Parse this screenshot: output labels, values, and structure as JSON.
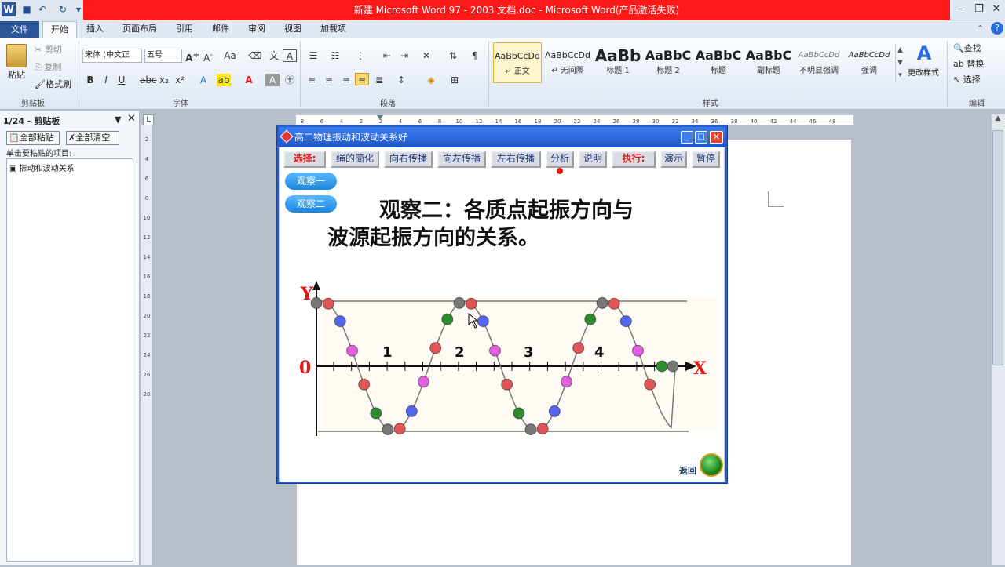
{
  "window": {
    "title": "新建 Microsoft Word 97 - 2003 文档.doc - Microsoft Word(产品激活失败)"
  },
  "tabs": [
    "文件",
    "开始",
    "插入",
    "页面布局",
    "引用",
    "邮件",
    "审阅",
    "视图",
    "加载项"
  ],
  "clipboard": {
    "paste": "粘贴",
    "cut": "剪切",
    "copy": "复制",
    "format_painter": "格式刷",
    "label": "剪贴板"
  },
  "font": {
    "name": "宋体 (中文正",
    "size": "五号",
    "label": "字体"
  },
  "paragraph": {
    "label": "段落"
  },
  "styles": {
    "label": "样式",
    "items": [
      {
        "preview": "AaBbCcDd",
        "name": "↵ 正文"
      },
      {
        "preview": "AaBbCcDd",
        "name": "↵ 无间隔"
      },
      {
        "preview": "AaBb",
        "name": "标题 1"
      },
      {
        "preview": "AaBbC",
        "name": "标题 2"
      },
      {
        "preview": "AaBbC",
        "name": "标题"
      },
      {
        "preview": "AaBbC",
        "name": "副标题"
      },
      {
        "preview": "AaBbCcDd",
        "name": "不明显强调"
      },
      {
        "preview": "AaBbCcDd",
        "name": "强调"
      }
    ],
    "change_styles": "更改样式"
  },
  "editing": {
    "find": "查找",
    "replace": "替换",
    "select": "选择",
    "label": "编辑"
  },
  "clip_pane": {
    "title": "1/24 - 剪贴板",
    "paste_all": "全部粘贴",
    "clear_all": "全部清空",
    "hint": "单击要粘贴的项目:",
    "item": "振动和波动关系"
  },
  "ruler": {
    "h_ticks": [
      "8",
      "6",
      "4",
      "2",
      "2",
      "4",
      "6",
      "8",
      "10",
      "12",
      "14",
      "16",
      "18",
      "20",
      "22",
      "24",
      "26",
      "28",
      "30",
      "32",
      "34",
      "36",
      "38",
      "40",
      "42",
      "44",
      "46",
      "48"
    ],
    "v_ticks": [
      "2",
      "4",
      "6",
      "8",
      "10",
      "12",
      "14",
      "16",
      "18",
      "20",
      "22",
      "24",
      "26",
      "28"
    ]
  },
  "app": {
    "title": "高二物理振动和波动关系好",
    "select_label": "选择:",
    "buttons": [
      "绳的简化",
      "向右传播",
      "向左传播",
      "左右传播",
      "分析",
      "说明"
    ],
    "exec_label": "执行:",
    "exec_buttons": [
      "演示",
      "暂停"
    ],
    "side_buttons": [
      "观察一",
      "观察二"
    ],
    "heading_line1": "观察二：各质点起振方向与",
    "heading_line2": "波源起振方向的关系。",
    "axis_y": "Y",
    "axis_x": "X",
    "origin": "0",
    "point_labels": [
      "1",
      "2",
      "3",
      "4"
    ],
    "return_label": "返回"
  }
}
